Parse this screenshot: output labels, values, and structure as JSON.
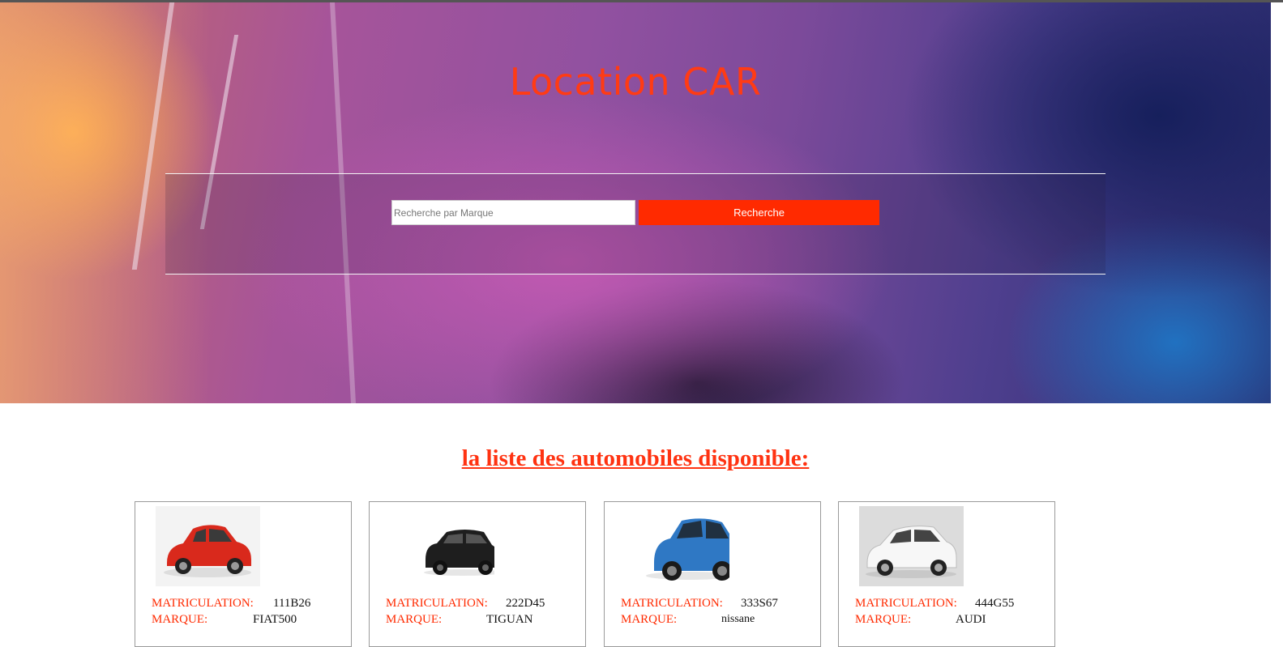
{
  "hero": {
    "site_title": "Location CAR",
    "search_placeholder": "Recherche par Marque",
    "search_value": "",
    "search_button_label": "Recherche"
  },
  "section": {
    "title": "la liste des automobiles disponible:"
  },
  "cars": [
    {
      "image": "red-fiat-500-photo",
      "color": "#d9291c",
      "matricule_label": "MATRICULATION:",
      "matricule": "111B26",
      "marque_label": "MARQUE:",
      "marque": "FIAT500"
    },
    {
      "image": "black-vw-tiguan-photo",
      "color": "#1e1e1e",
      "matricule_label": "MATRICULATION:",
      "matricule": "222D45",
      "marque_label": "MARQUE:",
      "marque": "TIGUAN"
    },
    {
      "image": "blue-nissan-qashqai-photo",
      "color": "#2f78c4",
      "matricule_label": "MATRICULATION:",
      "matricule": "333S67",
      "marque_label": "MARQUE:",
      "marque": "nissane"
    },
    {
      "image": "white-audi-a3-photo",
      "color": "#f4f4f4",
      "matricule_label": "MATRICULATION:",
      "matricule": "444G55",
      "marque_label": "MARQUE:",
      "marque": "AUDI"
    }
  ],
  "colors": {
    "accent": "#ff2a00",
    "title": "#ff3b14"
  }
}
